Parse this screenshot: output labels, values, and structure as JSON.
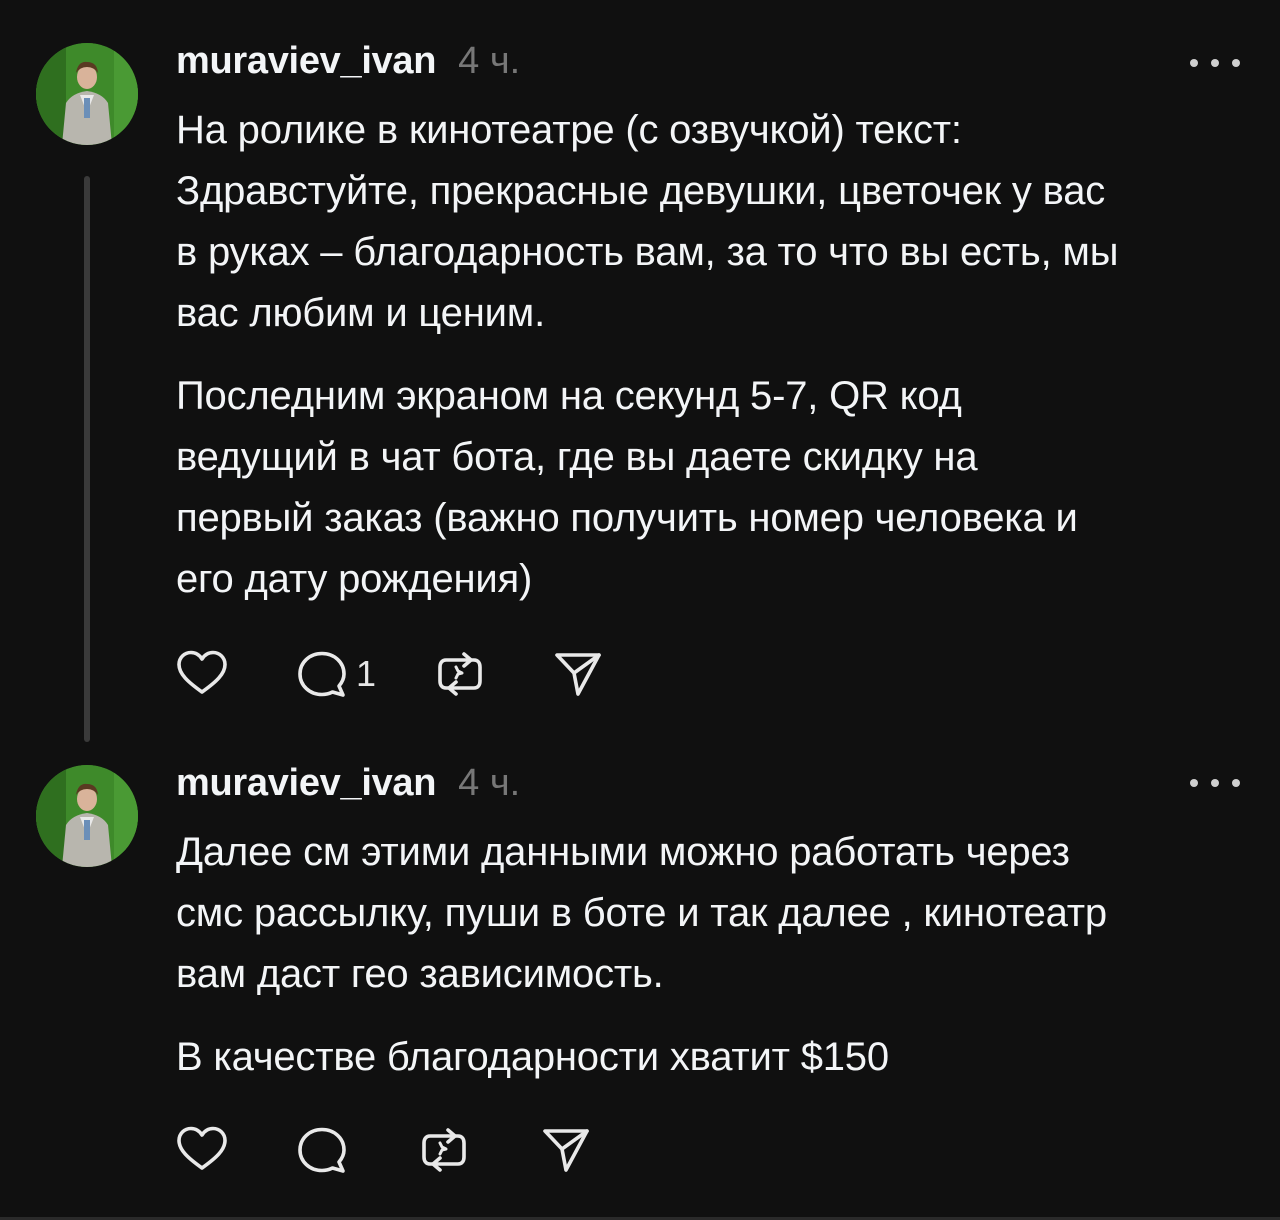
{
  "colors": {
    "background": "#101010",
    "text": "#f3f5f7",
    "muted": "#777777",
    "thread_line": "#3a3a3a",
    "avatar_background": "#3e8a2a"
  },
  "icons": {
    "like": "heart-icon",
    "reply": "comment-bubble-icon",
    "repost": "repost-arrows-icon",
    "share": "send-paper-plane-icon",
    "more": "more-dots-icon"
  },
  "posts": [
    {
      "username": "muraviev_ivan",
      "time": "4 ч.",
      "paragraphs": [
        "На ролике в кинотеатре (с озвучкой) текст:\nЗдравстуйте, прекрасные девушки, цветочек у вас\nв руках – благодарность вам, за то что вы есть, мы\nвас любим и ценим.",
        "Последним экраном на секунд 5-7, QR код\nведущий в чат бота, где вы даете скидку на\nпервый заказ (важно получить номер человека и\nего дату рождения)"
      ],
      "reply_count": "1"
    },
    {
      "username": "muraviev_ivan",
      "time": "4 ч.",
      "paragraphs": [
        "Далее см этими данными можно работать через\nсмс рассылку, пуши в боте и так далее , кинотеатр\nвам даст гео зависимость.",
        "В качестве благодарности хватит $150"
      ]
    }
  ]
}
